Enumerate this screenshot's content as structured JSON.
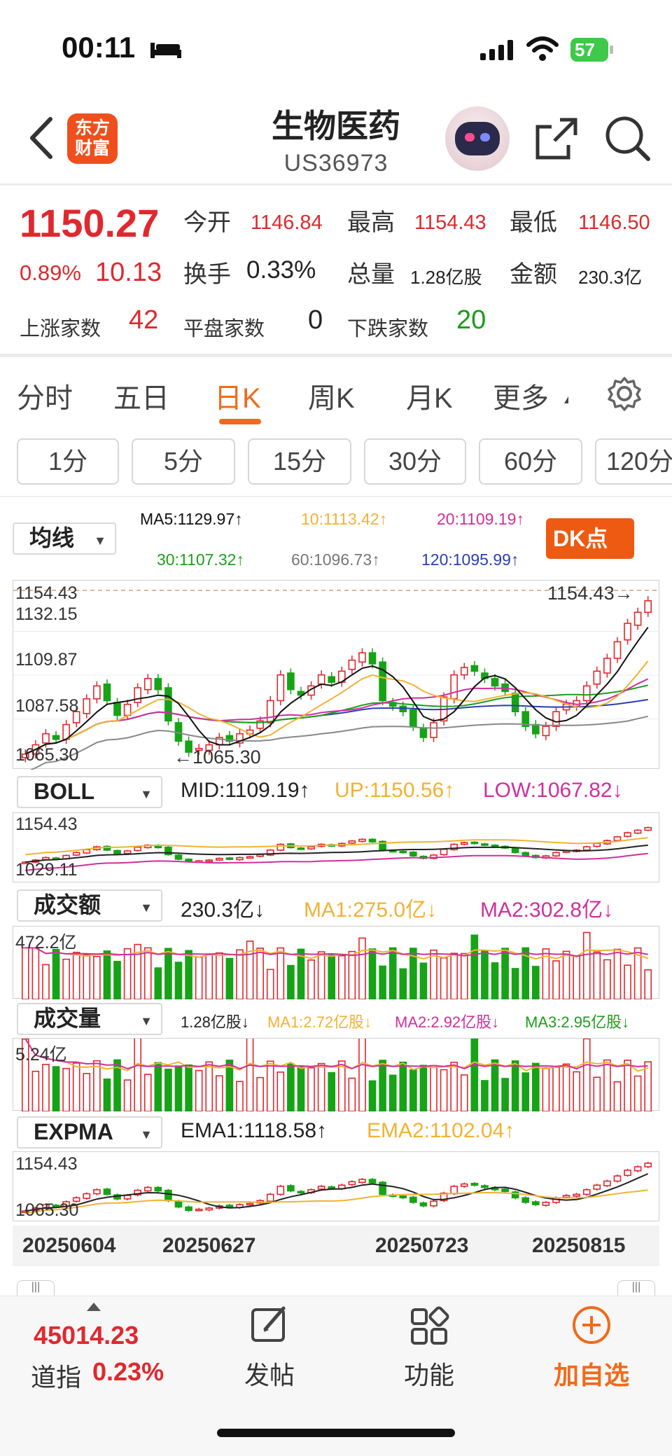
{
  "status_bar": {
    "time": "00:11",
    "battery": "57",
    "icons": [
      "bed-icon",
      "signal-icon",
      "wifi-icon",
      "battery-icon"
    ]
  },
  "nav": {
    "logo": [
      "东方",
      "财富"
    ],
    "title": "生物医药",
    "code": "US36973",
    "icons": [
      "back-icon",
      "robot-avatar",
      "share-icon",
      "search-icon"
    ]
  },
  "quote": {
    "price": "1150.27",
    "change_pct": "0.89%",
    "change": "10.13",
    "open_label": "今开",
    "open": "1146.84",
    "high_label": "最高",
    "high": "1154.43",
    "low_label": "最低",
    "low": "1146.50",
    "turnover_label": "换手",
    "turnover": "0.33%",
    "volume_label": "总量",
    "volume": "1.28亿股",
    "amount_label": "金额",
    "amount": "230.3亿",
    "up_label": "上涨家数",
    "up": "42",
    "flat_label": "平盘家数",
    "flat": "0",
    "down_label": "下跌家数",
    "down": "20"
  },
  "tabs": [
    "分时",
    "五日",
    "日K",
    "周K",
    "月K",
    "更多"
  ],
  "active_tab": "日K",
  "periods": [
    "1分",
    "5分",
    "15分",
    "30分",
    "60分",
    "120分"
  ],
  "main_chart": {
    "selector": "均线",
    "ma5": "MA5:1129.97↑",
    "ma10": "10:1113.42↑",
    "ma20": "20:1109.19↑",
    "ma30": "30:1107.32↑",
    "ma60": "60:1096.73↑",
    "ma120": "120:1095.99↑",
    "dk_button": "DK点",
    "y_labels": [
      "1154.43",
      "1132.15",
      "1109.87",
      "1087.58",
      "1065.30"
    ],
    "max_label": "1154.43→",
    "min_label": "←1065.30"
  },
  "boll": {
    "selector": "BOLL",
    "mid": "MID:1109.19↑",
    "up": "UP:1150.56↑",
    "low": "LOW:1067.82↓",
    "top": "1154.43",
    "bottom": "1029.11"
  },
  "amount": {
    "selector": "成交额",
    "value": "230.3亿↓",
    "ma1": "MA1:275.0亿↓",
    "ma2": "MA2:302.8亿↓",
    "top": "472.2亿"
  },
  "volume": {
    "selector": "成交量",
    "value": "1.28亿股↓",
    "ma1": "MA1:2.72亿股↓",
    "ma2": "MA2:2.92亿股↓",
    "ma3": "MA3:2.95亿股↓",
    "top": "5.24亿"
  },
  "expma": {
    "selector": "EXPMA",
    "ema1": "EMA1:1118.58↑",
    "ema2": "EMA2:1102.04↑",
    "top": "1154.43",
    "bottom": "1065.30"
  },
  "dates": [
    "20250604",
    "20250627",
    "20250723",
    "20250815"
  ],
  "colors": {
    "up": "#e0282e",
    "down": "#16a316",
    "accent": "#f16a1a",
    "ma5": "#111111",
    "ma10": "#f2b233",
    "ma20": "#d02f9c",
    "ma30": "#1e9e1e",
    "ma60": "#888888",
    "ma120": "#2a3fb0"
  },
  "bottom_bar": {
    "index_value": "45014.23",
    "index_name": "道指",
    "index_pct": "0.23%",
    "post": "发帖",
    "function": "功能",
    "add": "加自选"
  },
  "chart_data": {
    "type": "candlestick",
    "closes": [
      1067,
      1072,
      1078,
      1075,
      1083,
      1090,
      1097,
      1104,
      1096,
      1088,
      1094,
      1103,
      1108,
      1102,
      1085,
      1074,
      1068,
      1070,
      1072,
      1076,
      1074,
      1078,
      1080,
      1085,
      1096,
      1110,
      1102,
      1099,
      1104,
      1110,
      1106,
      1112,
      1118,
      1122,
      1116,
      1096,
      1093,
      1090,
      1082,
      1076,
      1084,
      1098,
      1110,
      1114,
      1112,
      1108,
      1104,
      1101,
      1090,
      1082,
      1078,
      1082,
      1090,
      1094,
      1096,
      1104,
      1112,
      1119,
      1128,
      1138,
      1144,
      1150.27
    ],
    "ylim": [
      1065.3,
      1154.43
    ]
  }
}
